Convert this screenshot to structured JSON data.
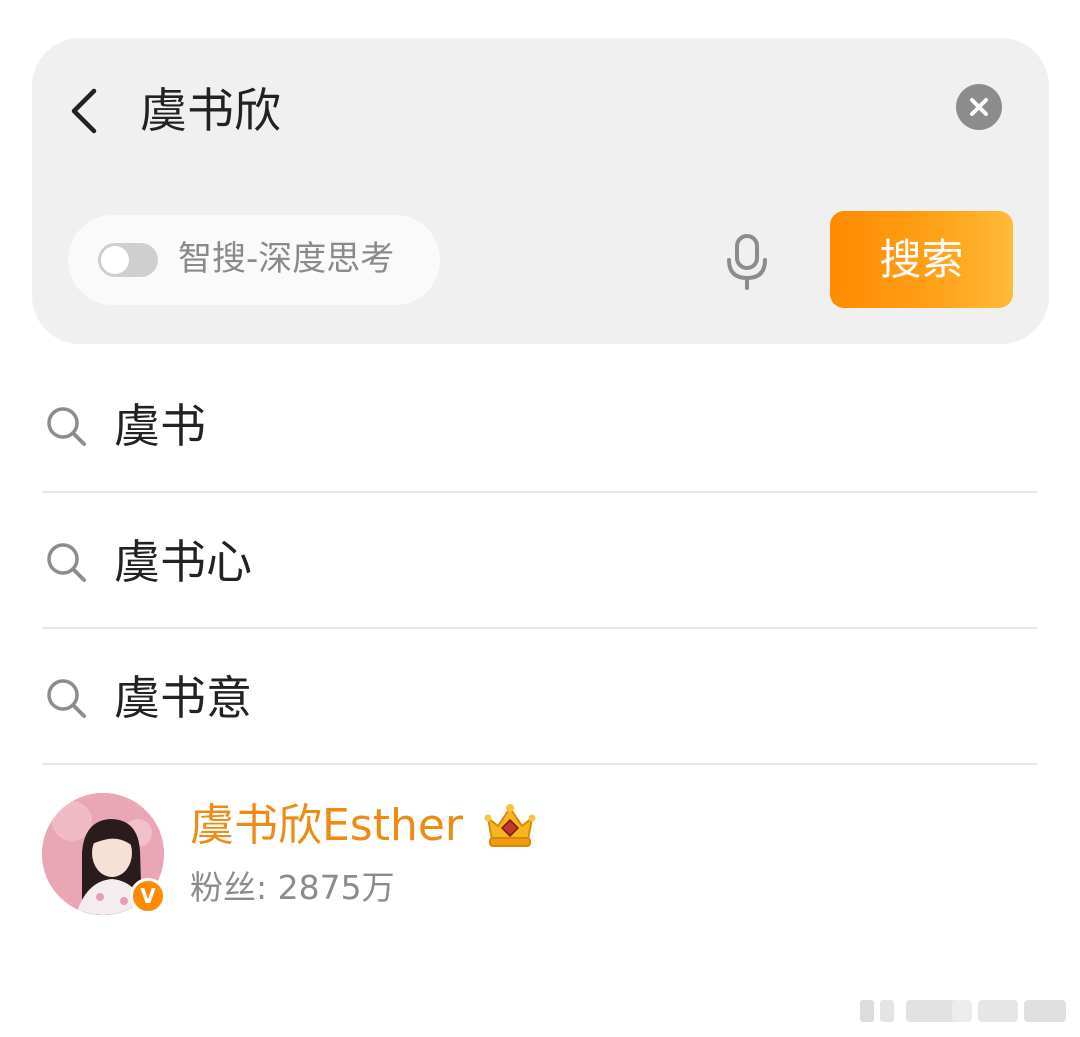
{
  "search_bar": {
    "query": "虞书欣",
    "deep_think_label": "智搜-深度思考",
    "deep_think_enabled": false,
    "search_button_label": "搜索",
    "accent_color": "#ff8a00"
  },
  "suggestions": [
    {
      "label": "虞书"
    },
    {
      "label": "虞书心"
    },
    {
      "label": "虞书意"
    }
  ],
  "user_result": {
    "name": "虞书欣Esther",
    "fans": "粉丝: 2875万",
    "verified": true,
    "badge_icon": "crown-icon",
    "name_color": "#ef8a13"
  },
  "icons": {
    "back": "chevron-left-icon",
    "clear": "close-circle-icon",
    "mic": "microphone-icon",
    "suggestion": "search-icon"
  }
}
